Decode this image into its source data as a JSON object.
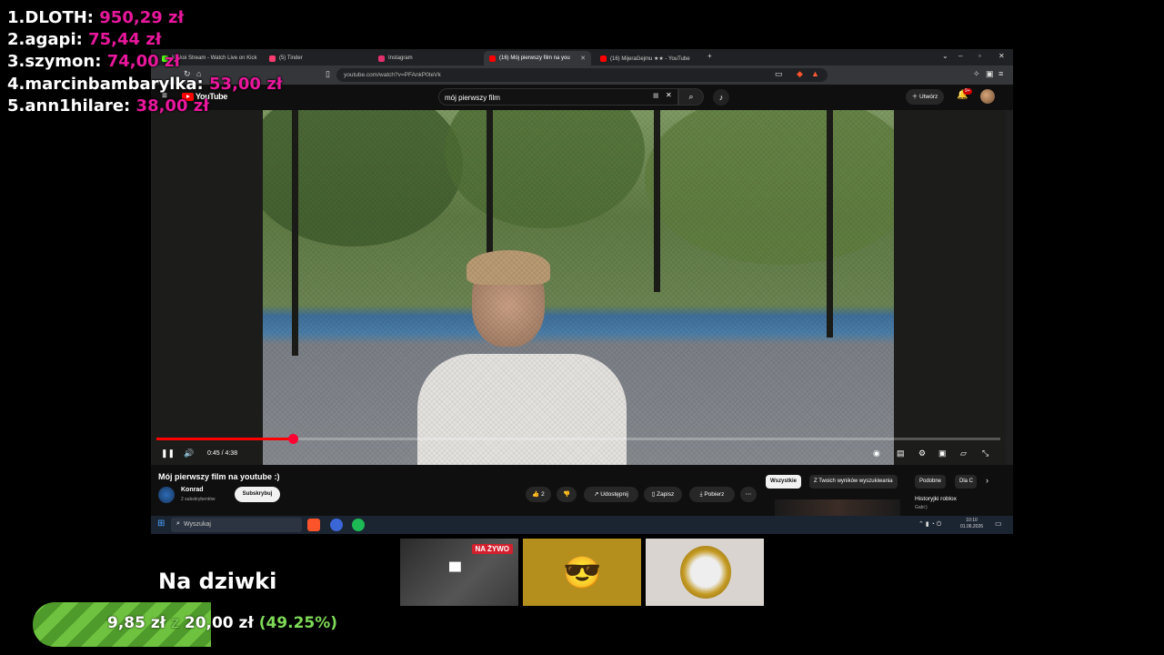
{
  "leaderboard": [
    {
      "rank": "1.",
      "name": "DLOTH:",
      "amount": "950,29 zł"
    },
    {
      "rank": "2.",
      "name": "agapi:",
      "amount": "75,44 zł"
    },
    {
      "rank": "3.",
      "name": "szymon:",
      "amount": "74,00 zł"
    },
    {
      "rank": "4.",
      "name": "marcinbambarylka:",
      "amount": "53,00 zł"
    },
    {
      "rank": "5.",
      "name": "ann1hilare:",
      "amount": "38,00 zł"
    }
  ],
  "browser": {
    "tabs": [
      {
        "label": "Kinkoi Stream - Watch Live on Kick",
        "icon": "kick-icon",
        "color": "#53fc18"
      },
      {
        "label": "(5) Tinder",
        "icon": "tinder-icon",
        "color": "#fe3c72"
      },
      {
        "label": "Instagram",
        "icon": "instagram-icon",
        "color": "#e1306c"
      },
      {
        "label": "(16) Mój pierwszy film na you",
        "icon": "youtube-icon",
        "color": "#ff0000"
      },
      {
        "label": "(16) MijeraGejmu ★★ - YouTube",
        "icon": "youtube-icon",
        "color": "#ff0000"
      }
    ],
    "url": "youtube.com/watch?v=PFAnkP0teVk"
  },
  "youtube": {
    "logo": "YouTube",
    "search_query": "mój pierwszy film",
    "create_label": "Utwórz",
    "notif_count": "9+",
    "video_time": "0:45 / 4:38",
    "progress": 0.162,
    "video_title": "Mój pierwszy film na youtube :)",
    "channel": "Konrad",
    "subscribers": "2 subskrybentów",
    "subscribe_label": "Subskrybuj",
    "likes": "2",
    "share_label": "Udostępnij",
    "save_label": "Zapisz",
    "download_label": "Pobierz",
    "chips": [
      "Wszystkie",
      "Z Twoich wyników wyszukiwania",
      "Podobne",
      "Dla C"
    ],
    "rec_title": "Historyjki roblox",
    "rec_sub": "Gabi:)"
  },
  "taskbar": {
    "search_placeholder": "Wyszukaj",
    "time": "10:10",
    "date": "01.06.2026"
  },
  "stream": {
    "goal_title": "Na dziwki",
    "goal_current": "9,85 zł",
    "goal_sep": "z",
    "goal_target": "20,00 zł",
    "goal_percent": "(49.25%)",
    "goal_fraction": 0.4925,
    "live_badge": "NA ŻYWO"
  }
}
